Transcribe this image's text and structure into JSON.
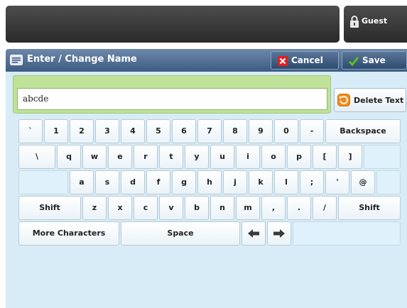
{
  "header": {
    "user_label": "Guest"
  },
  "title_bar": {
    "title": "Enter / Change Name",
    "cancel_label": "Cancel",
    "save_label": "Save"
  },
  "name_field": {
    "value": "abcde"
  },
  "delete_button": {
    "label": "Delete Text"
  },
  "keyboard": {
    "row1": [
      "`",
      "1",
      "2",
      "3",
      "4",
      "5",
      "6",
      "7",
      "8",
      "9",
      "0",
      "-"
    ],
    "backspace_label": "Backspace",
    "row2": [
      "\\",
      "q",
      "w",
      "e",
      "r",
      "t",
      "y",
      "u",
      "i",
      "o",
      "p",
      "[",
      "]"
    ],
    "row3": [
      "a",
      "s",
      "d",
      "f",
      "g",
      "h",
      "j",
      "k",
      "l",
      ";",
      "'",
      "@"
    ],
    "row4": [
      "z",
      "x",
      "c",
      "v",
      "b",
      "n",
      "m",
      ",",
      ".",
      "/"
    ],
    "shift_left_label": "Shift",
    "shift_right_label": "Shift",
    "more_label": "More Characters",
    "space_label": "Space",
    "left_arrow_icon": "arrow-left-icon",
    "right_arrow_icon": "arrow-right-icon"
  },
  "colors": {
    "title_bar": "#4f6e95",
    "panel": "#d7ecf6",
    "field_frame": "#bfe19a",
    "cancel_icon": "#e02020",
    "save_icon": "#5fbf1f",
    "delete_icon": "#f08a1c"
  }
}
